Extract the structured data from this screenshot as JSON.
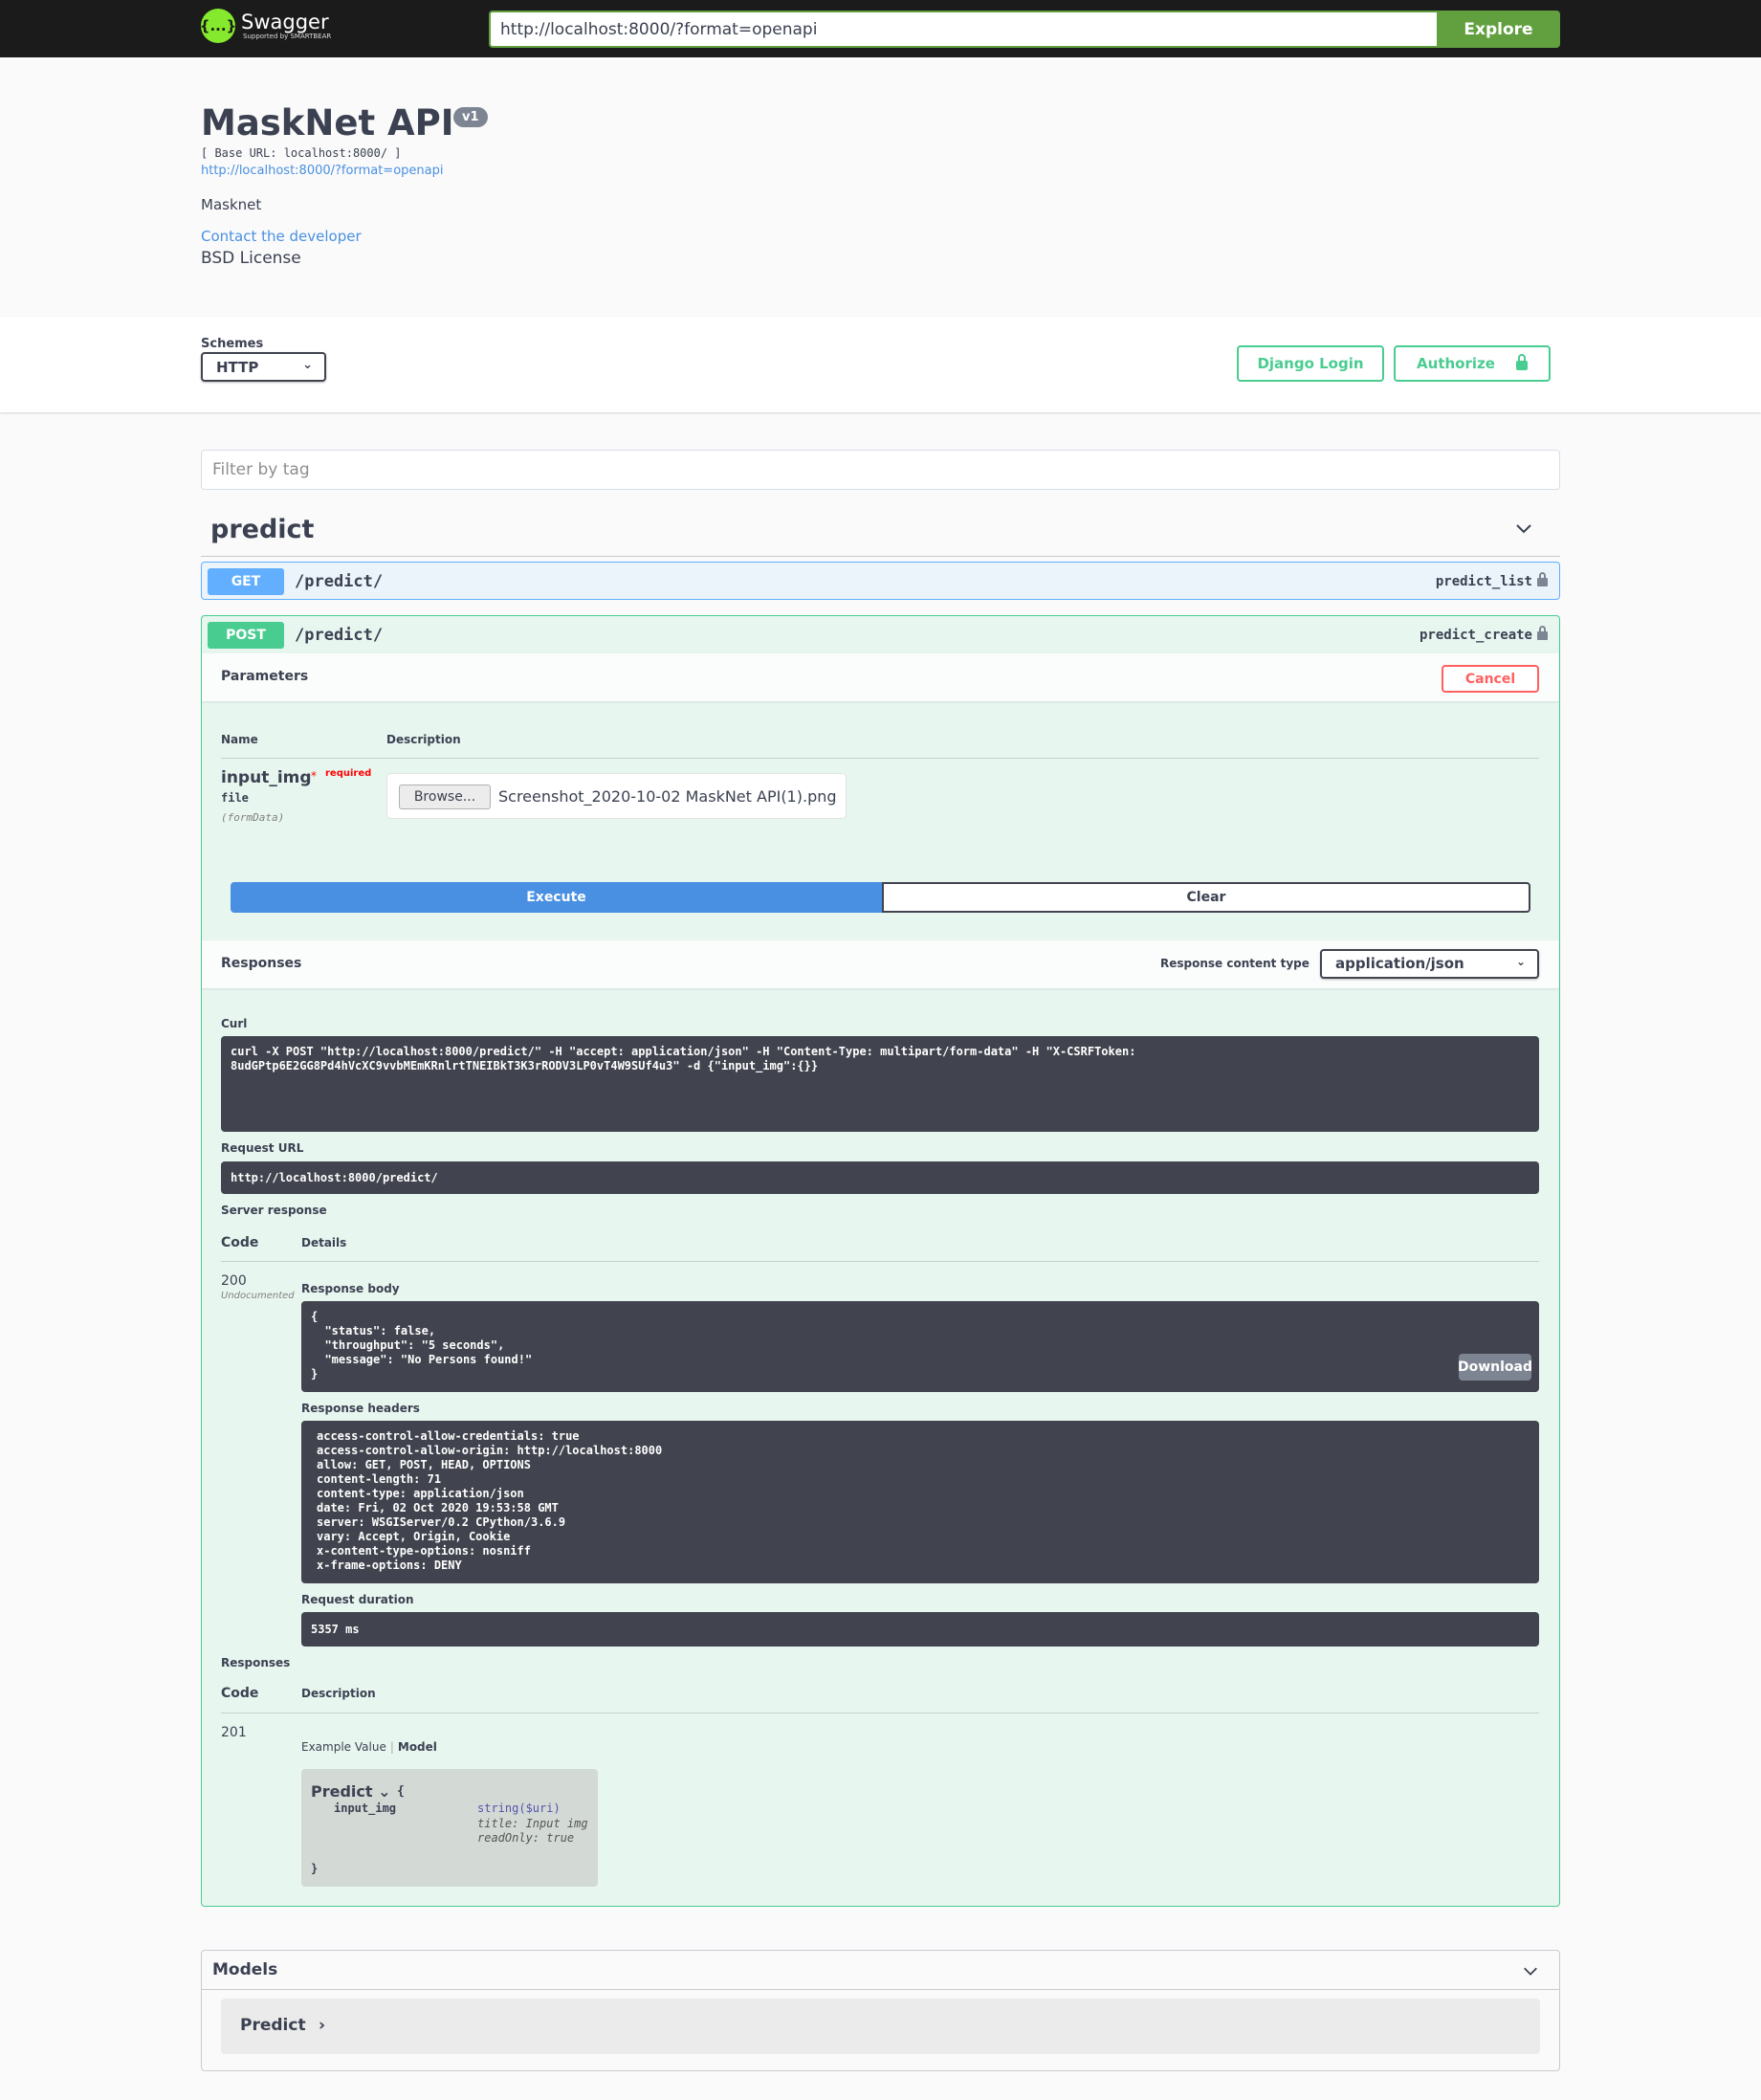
{
  "topbar": {
    "logo_icon": "{...}",
    "logo_text": "Swagger",
    "logo_sub": "Supported by SMARTBEAR",
    "url_value": "http://localhost:8000/?format=openapi",
    "explore_label": "Explore",
    "accent_color": "#62a03f"
  },
  "info": {
    "title": "MaskNet API",
    "version": "v1",
    "base_url": "[ Base URL: localhost:8000/ ]",
    "spec_link": "http://localhost:8000/?format=openapi",
    "description": "Masknet",
    "contact": "Contact the developer",
    "license": "BSD License"
  },
  "schemes": {
    "label": "Schemes",
    "selected": "HTTP",
    "django_login": "Django Login",
    "authorize": "Authorize"
  },
  "filter": {
    "placeholder": "Filter by tag"
  },
  "tag": {
    "name": "predict"
  },
  "operations": [
    {
      "method": "GET",
      "path": "/predict/",
      "operation_id": "predict_list",
      "color": "#61affe"
    },
    {
      "method": "POST",
      "path": "/predict/",
      "operation_id": "predict_create",
      "color": "#49cc90"
    }
  ],
  "parameters": {
    "title": "Parameters",
    "cancel": "Cancel",
    "col_name": "Name",
    "col_description": "Description",
    "param": {
      "name": "input_img",
      "star": "*",
      "required": "required",
      "type": "file",
      "in": "(formData)",
      "browse": "Browse...",
      "file_name": "Screenshot_2020-10-02 MaskNet API(1).png"
    },
    "execute": "Execute",
    "clear": "Clear"
  },
  "responses": {
    "title": "Responses",
    "content_type_label": "Response content type",
    "content_type": "application/json",
    "curl_label": "Curl",
    "curl": "curl -X POST \"http://localhost:8000/predict/\" -H \"accept: application/json\" -H \"Content-Type: multipart/form-data\" -H \"X-CSRFToken: \n8udGPtp6E2GG8Pd4hVcXC9vvbMEmKRnlrtTNEIBkT3K3rRODV3LP0vT4W9SUf4u3\" -d {\"input_img\":{}}",
    "request_url_label": "Request URL",
    "request_url": "http://localhost:8000/predict/",
    "server_response_label": "Server response",
    "col_code": "Code",
    "col_details": "Details",
    "code": "200",
    "undocumented": "Undocumented",
    "body_label": "Response body",
    "body": "{\n  \"status\": false,\n  \"throughput\": \"5 seconds\",\n  \"message\": \"No Persons found!\"\n}",
    "download": "Download",
    "headers_label": "Response headers",
    "headers": "access-control-allow-credentials: true\naccess-control-allow-origin: http://localhost:8000\nallow: GET, POST, HEAD, OPTIONS\ncontent-length: 71\ncontent-type: application/json\ndate: Fri, 02 Oct 2020 19:53:58 GMT\nserver: WSGIServer/0.2 CPython/3.6.9\nvary: Accept, Origin, Cookie\nx-content-type-options: nosniff\nx-frame-options: DENY",
    "duration_label": "Request duration",
    "duration": "5357 ms"
  },
  "documented_responses": {
    "title": "Responses",
    "col_code": "Code",
    "col_description": "Description",
    "code": "201",
    "example_value": "Example Value",
    "model_tab": "Model",
    "model": {
      "name": "Predict",
      "toggle": "⌄",
      "brace_open": "{",
      "prop": "input_img",
      "type": "string($uri)",
      "title": "title: Input img",
      "read_only": "readOnly: true",
      "brace_close": "}"
    }
  },
  "models": {
    "title": "Models",
    "items": [
      {
        "name": "Predict"
      }
    ]
  }
}
